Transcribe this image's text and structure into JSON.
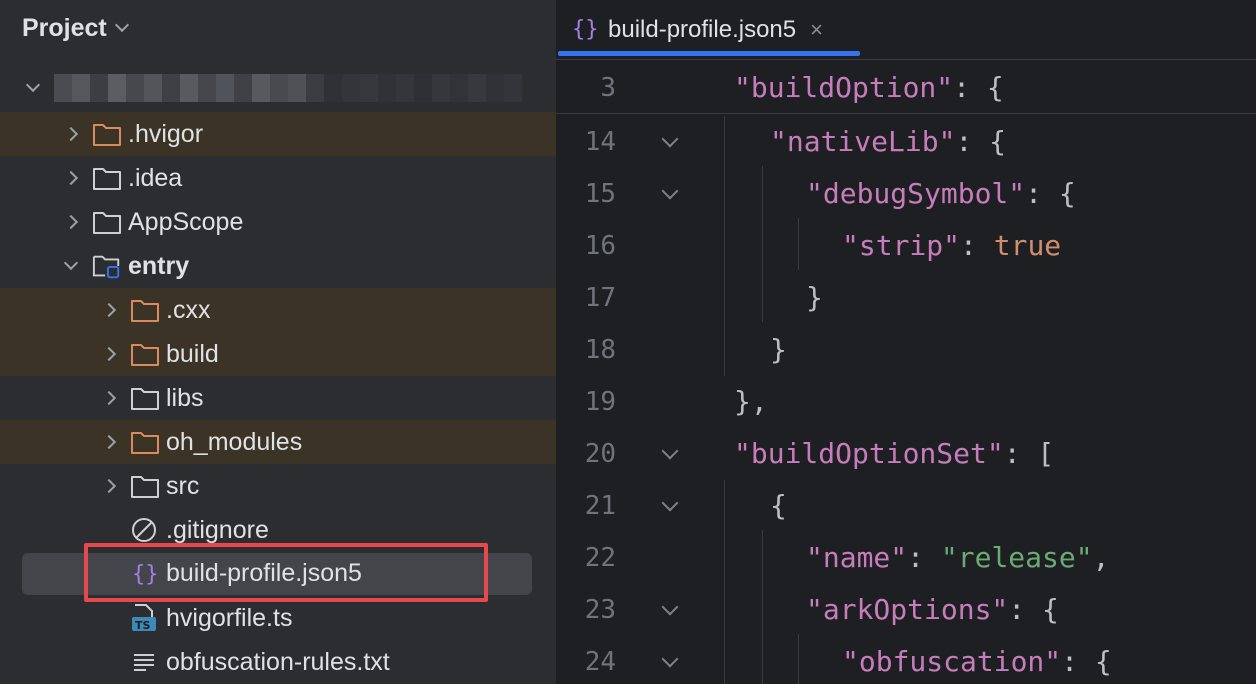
{
  "project_panel": {
    "title": "Project",
    "items": [
      {
        "label": ".hvigor",
        "kind": "folder",
        "excluded": true
      },
      {
        "label": ".idea",
        "kind": "folder",
        "excluded": false
      },
      {
        "label": "AppScope",
        "kind": "folder",
        "excluded": false
      },
      {
        "label": "entry",
        "kind": "module",
        "excluded": false
      },
      {
        "label": ".cxx",
        "kind": "folder",
        "excluded": true
      },
      {
        "label": "build",
        "kind": "folder",
        "excluded": true
      },
      {
        "label": "libs",
        "kind": "folder",
        "excluded": false
      },
      {
        "label": "oh_modules",
        "kind": "folder",
        "excluded": true
      },
      {
        "label": "src",
        "kind": "folder",
        "excluded": false
      },
      {
        "label": ".gitignore",
        "kind": "ignore-file"
      },
      {
        "label": "build-profile.json5",
        "kind": "json-file",
        "selected": true
      },
      {
        "label": "hvigorfile.ts",
        "kind": "ts-file"
      },
      {
        "label": "obfuscation-rules.txt",
        "kind": "text-file"
      }
    ]
  },
  "editor": {
    "tab": {
      "label": "build-profile.json5",
      "close": "×"
    },
    "lines": [
      {
        "num": "3",
        "key": "\"buildOption\"",
        "rest": ": {"
      },
      {
        "num": "14",
        "key": "\"nativeLib\"",
        "rest": ": {"
      },
      {
        "num": "15",
        "key": "\"debugSymbol\"",
        "rest": ": {"
      },
      {
        "num": "16",
        "key": "\"strip\"",
        "rest": ": ",
        "bool": "true"
      },
      {
        "num": "17",
        "text": "}"
      },
      {
        "num": "18",
        "text": "}"
      },
      {
        "num": "19",
        "text": "},"
      },
      {
        "num": "20",
        "key": "\"buildOptionSet\"",
        "rest": ": ["
      },
      {
        "num": "21",
        "text": "{"
      },
      {
        "num": "22",
        "key": "\"name\"",
        "rest": ": ",
        "str": "\"release\"",
        "tail": ","
      },
      {
        "num": "23",
        "key": "\"arkOptions\"",
        "rest": ": {"
      },
      {
        "num": "24",
        "key": "\"obfuscation\"",
        "rest": ": {"
      }
    ]
  },
  "colors": {
    "excluded_row": "#3b3325",
    "highlight_box": "#e5484d",
    "tab_underline": "#3574f0",
    "json_key": "#c77dbb",
    "json_string": "#6aab73",
    "json_bool": "#cf8e6d"
  }
}
